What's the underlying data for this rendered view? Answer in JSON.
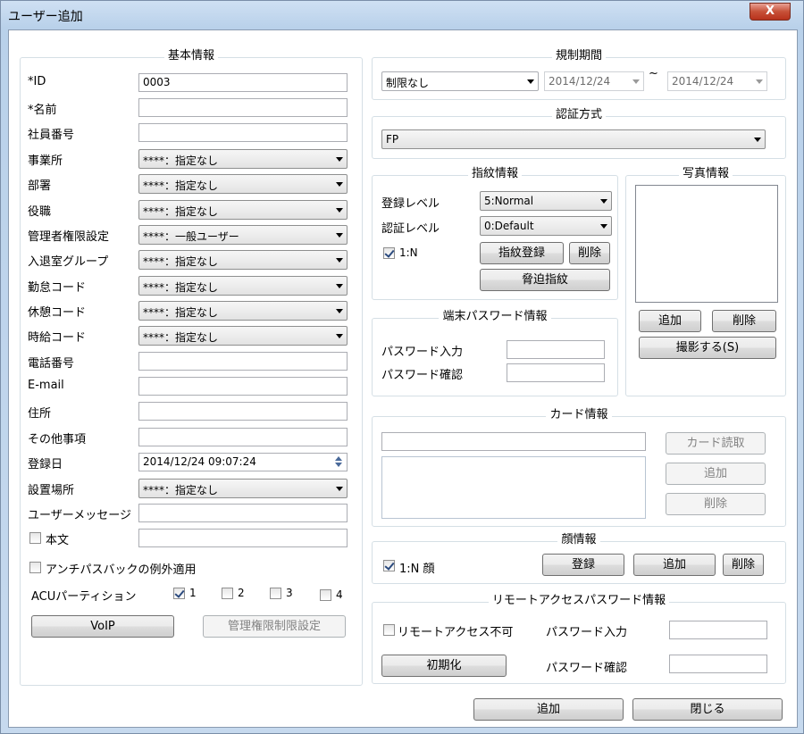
{
  "window": {
    "title": "ユーザー追加",
    "close_label": "X"
  },
  "basic": {
    "title": "基本情報",
    "id_label": "*ID",
    "id_value": "0003",
    "name_label": "*名前",
    "name_value": "",
    "employee_no_label": "社員番号",
    "office_label": "事業所",
    "office_value": "****：指定なし",
    "dept_label": "部署",
    "dept_value": "****：指定なし",
    "position_label": "役職",
    "position_value": "****：指定なし",
    "admin_label": "管理者権限設定",
    "admin_value": "****：一般ユーザー",
    "room_group_label": "入退室グループ",
    "room_group_value": "****：指定なし",
    "attendance_label": "勤怠コード",
    "attendance_value": "****：指定なし",
    "break_label": "休憩コード",
    "break_value": "****：指定なし",
    "hourly_label": "時給コード",
    "hourly_value": "****：指定なし",
    "phone_label": "電話番号",
    "email_label": "E-mail",
    "address_label": "住所",
    "other_label": "その他事項",
    "regdate_label": "登録日",
    "regdate_value": "2014/12/24 09:07:24",
    "location_label": "設置場所",
    "location_value": "****：指定なし",
    "user_message_label": "ユーザーメッセージ",
    "body_label": "本文",
    "antipassback_label": "アンチパスバックの例外適用",
    "acu_label": "ACUパーティション",
    "acu_options": [
      "1",
      "2",
      "3",
      "4"
    ],
    "voip_label": "VoIP",
    "admin_restrict_label": "管理権限制限設定"
  },
  "restriction": {
    "title": "規制期間",
    "mode_value": "制限なし",
    "from_value": "2014/12/24",
    "tilde": "~",
    "to_value": "2014/12/24"
  },
  "auth": {
    "title": "認証方式",
    "method_value": "FP"
  },
  "fingerprint": {
    "title": "指紋情報",
    "reg_level_label": "登録レベル",
    "reg_level_value": "5:Normal",
    "auth_level_label": "認証レベル",
    "auth_level_value": "0:Default",
    "one_n_label": "1:N",
    "register_button": "指紋登録",
    "delete_button": "削除",
    "duress_button": "脅迫指紋"
  },
  "photo": {
    "title": "写真情報",
    "add_button": "追加",
    "delete_button": "削除",
    "capture_button": "撮影する(S)"
  },
  "terminal_password": {
    "title": "端末パスワード情報",
    "input_label": "パスワード入力",
    "confirm_label": "パスワード確認"
  },
  "card": {
    "title": "カード情報",
    "read_button": "カード読取",
    "add_button": "追加",
    "delete_button": "削除"
  },
  "face": {
    "title": "顔情報",
    "one_n_label": "1:N 顔",
    "register_button": "登録",
    "add_button": "追加",
    "delete_button": "削除"
  },
  "remote": {
    "title": "リモートアクセスパスワード情報",
    "disable_label": "リモートアクセス不可",
    "input_label": "パスワード入力",
    "confirm_label": "パスワード確認",
    "init_button": "初期化"
  },
  "footer": {
    "add_button": "追加",
    "close_button": "閉じる"
  }
}
